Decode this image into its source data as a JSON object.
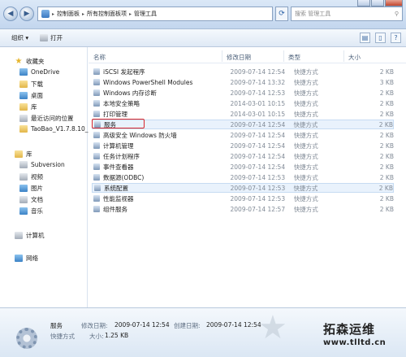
{
  "address": {
    "crumbs": [
      "控制面板",
      "所有控制面板项",
      "管理工具"
    ]
  },
  "search": {
    "placeholder": "搜索 管理工具"
  },
  "toolbar": {
    "organize": "组织 ▾",
    "open": "打开"
  },
  "navpane": {
    "favorites": "收藏夹",
    "items": [
      "OneDrive",
      "下载",
      "桌面",
      "库",
      "最近访问的位置",
      "TaoBao_V1.7.8.10_"
    ],
    "libraries": "库",
    "libs": [
      "Subversion",
      "视频",
      "图片",
      "文档",
      "音乐"
    ],
    "computer": "计算机",
    "network": "网络"
  },
  "columns": {
    "name": "名称",
    "modified": "修改日期",
    "type": "类型",
    "size": "大小"
  },
  "rows": [
    {
      "name": "iSCSI 发起程序",
      "date": "2009-07-14 12:54",
      "type": "快捷方式",
      "size": "2 KB"
    },
    {
      "name": "Windows PowerShell Modules",
      "date": "2009-07-14 13:32",
      "type": "快捷方式",
      "size": "3 KB"
    },
    {
      "name": "Windows 内存诊断",
      "date": "2009-07-14 12:53",
      "type": "快捷方式",
      "size": "2 KB"
    },
    {
      "name": "本地安全策略",
      "date": "2014-03-01 10:15",
      "type": "快捷方式",
      "size": "2 KB"
    },
    {
      "name": "打印管理",
      "date": "2014-03-01 10:15",
      "type": "快捷方式",
      "size": "2 KB"
    },
    {
      "name": "服务",
      "date": "2009-07-14 12:54",
      "type": "快捷方式",
      "size": "2 KB"
    },
    {
      "name": "高级安全 Windows 防火墙",
      "date": "2009-07-14 12:54",
      "type": "快捷方式",
      "size": "2 KB"
    },
    {
      "name": "计算机管理",
      "date": "2009-07-14 12:54",
      "type": "快捷方式",
      "size": "2 KB"
    },
    {
      "name": "任务计划程序",
      "date": "2009-07-14 12:54",
      "type": "快捷方式",
      "size": "2 KB"
    },
    {
      "name": "事件查看器",
      "date": "2009-07-14 12:54",
      "type": "快捷方式",
      "size": "2 KB"
    },
    {
      "name": "数据源(ODBC)",
      "date": "2009-07-14 12:53",
      "type": "快捷方式",
      "size": "2 KB"
    },
    {
      "name": "系统配置",
      "date": "2009-07-14 12:53",
      "type": "快捷方式",
      "size": "2 KB"
    },
    {
      "name": "性能监视器",
      "date": "2009-07-14 12:53",
      "type": "快捷方式",
      "size": "2 KB"
    },
    {
      "name": "组件服务",
      "date": "2009-07-14 12:57",
      "type": "快捷方式",
      "size": "2 KB"
    }
  ],
  "details": {
    "name": "服务",
    "modified_label": "修改日期:",
    "modified_value": "2009-07-14 12:54",
    "created_label": "创建日期:",
    "created_value": "2009-07-14 12:54",
    "type": "快捷方式",
    "size_label": "大小:",
    "size_value": "1.25 KB"
  },
  "watermark": {
    "cn": "拓森运维",
    "url": "www.tlltd.cn"
  },
  "colors": {
    "highlight_box": "#d8262b",
    "selected_row": "#e9f2fc"
  }
}
